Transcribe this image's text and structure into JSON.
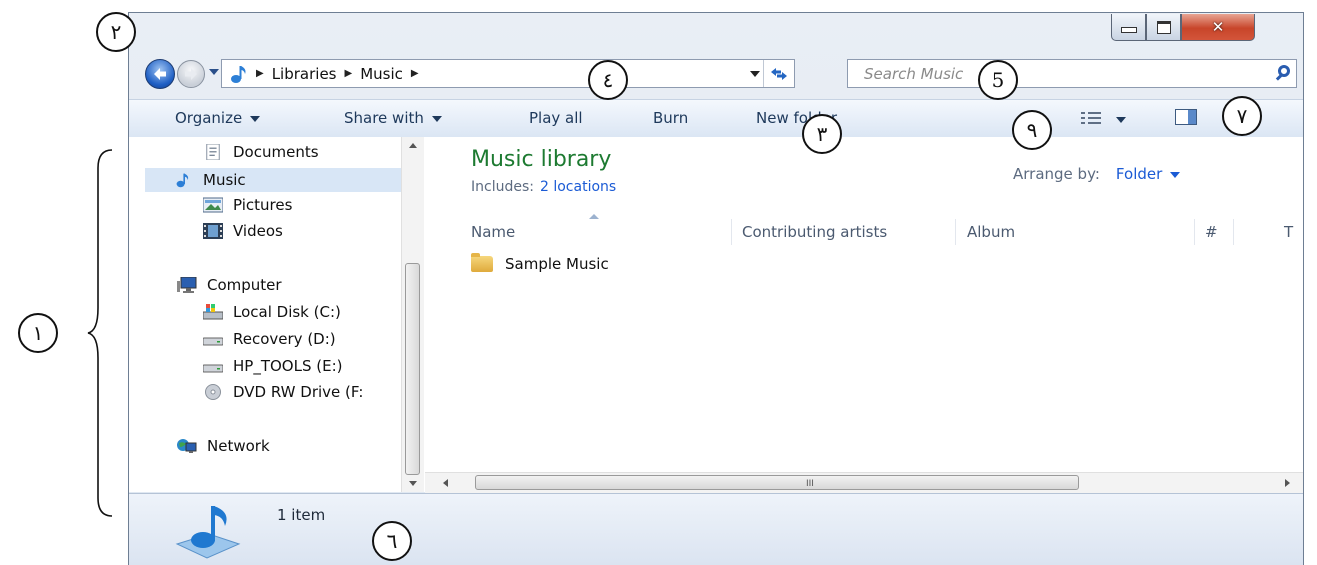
{
  "window": {
    "minimize_glyph": "",
    "close_glyph": "✕"
  },
  "address_bar": {
    "crumbs": [
      "Libraries",
      "Music"
    ],
    "separator": "▶"
  },
  "search": {
    "placeholder": "Search Music"
  },
  "toolbar": {
    "organize": "Organize",
    "share_with": "Share with",
    "play_all": "Play all",
    "burn": "Burn",
    "new_folder": "New folder"
  },
  "nav_pane": {
    "items": [
      {
        "label": "Documents",
        "icon": "documents-icon"
      },
      {
        "label": "Music",
        "icon": "music-note-icon",
        "selected": true
      },
      {
        "label": "Pictures",
        "icon": "pictures-icon"
      },
      {
        "label": "Videos",
        "icon": "videos-icon"
      },
      {
        "label": "Computer",
        "icon": "computer-icon"
      },
      {
        "label": "Local Disk (C:)",
        "icon": "local-disk-icon"
      },
      {
        "label": "Recovery (D:)",
        "icon": "drive-icon"
      },
      {
        "label": "HP_TOOLS (E:)",
        "icon": "drive-icon"
      },
      {
        "label": "DVD RW Drive (F:",
        "icon": "dvd-drive-icon"
      },
      {
        "label": "Network",
        "icon": "network-icon"
      }
    ]
  },
  "library": {
    "title": "Music library",
    "includes_label": "Includes:",
    "includes_link": "2 locations",
    "arrange_label": "Arrange by:",
    "arrange_value": "Folder"
  },
  "columns": [
    "Name",
    "Contributing artists",
    "Album",
    "#",
    "T"
  ],
  "files": [
    {
      "name": "Sample Music",
      "icon": "folder-icon"
    }
  ],
  "status": {
    "count": "1 item"
  },
  "annotations": {
    "one": "١",
    "two": "٢",
    "three": "٣",
    "four": "٤",
    "five": "5",
    "six": "٦",
    "seven": "٧",
    "nine": "٩"
  },
  "colors": {
    "library_title": "#1d7a31",
    "link": "#1b5bd5",
    "toolbar_text": "#1e395b",
    "close_button": "#c8452a"
  }
}
